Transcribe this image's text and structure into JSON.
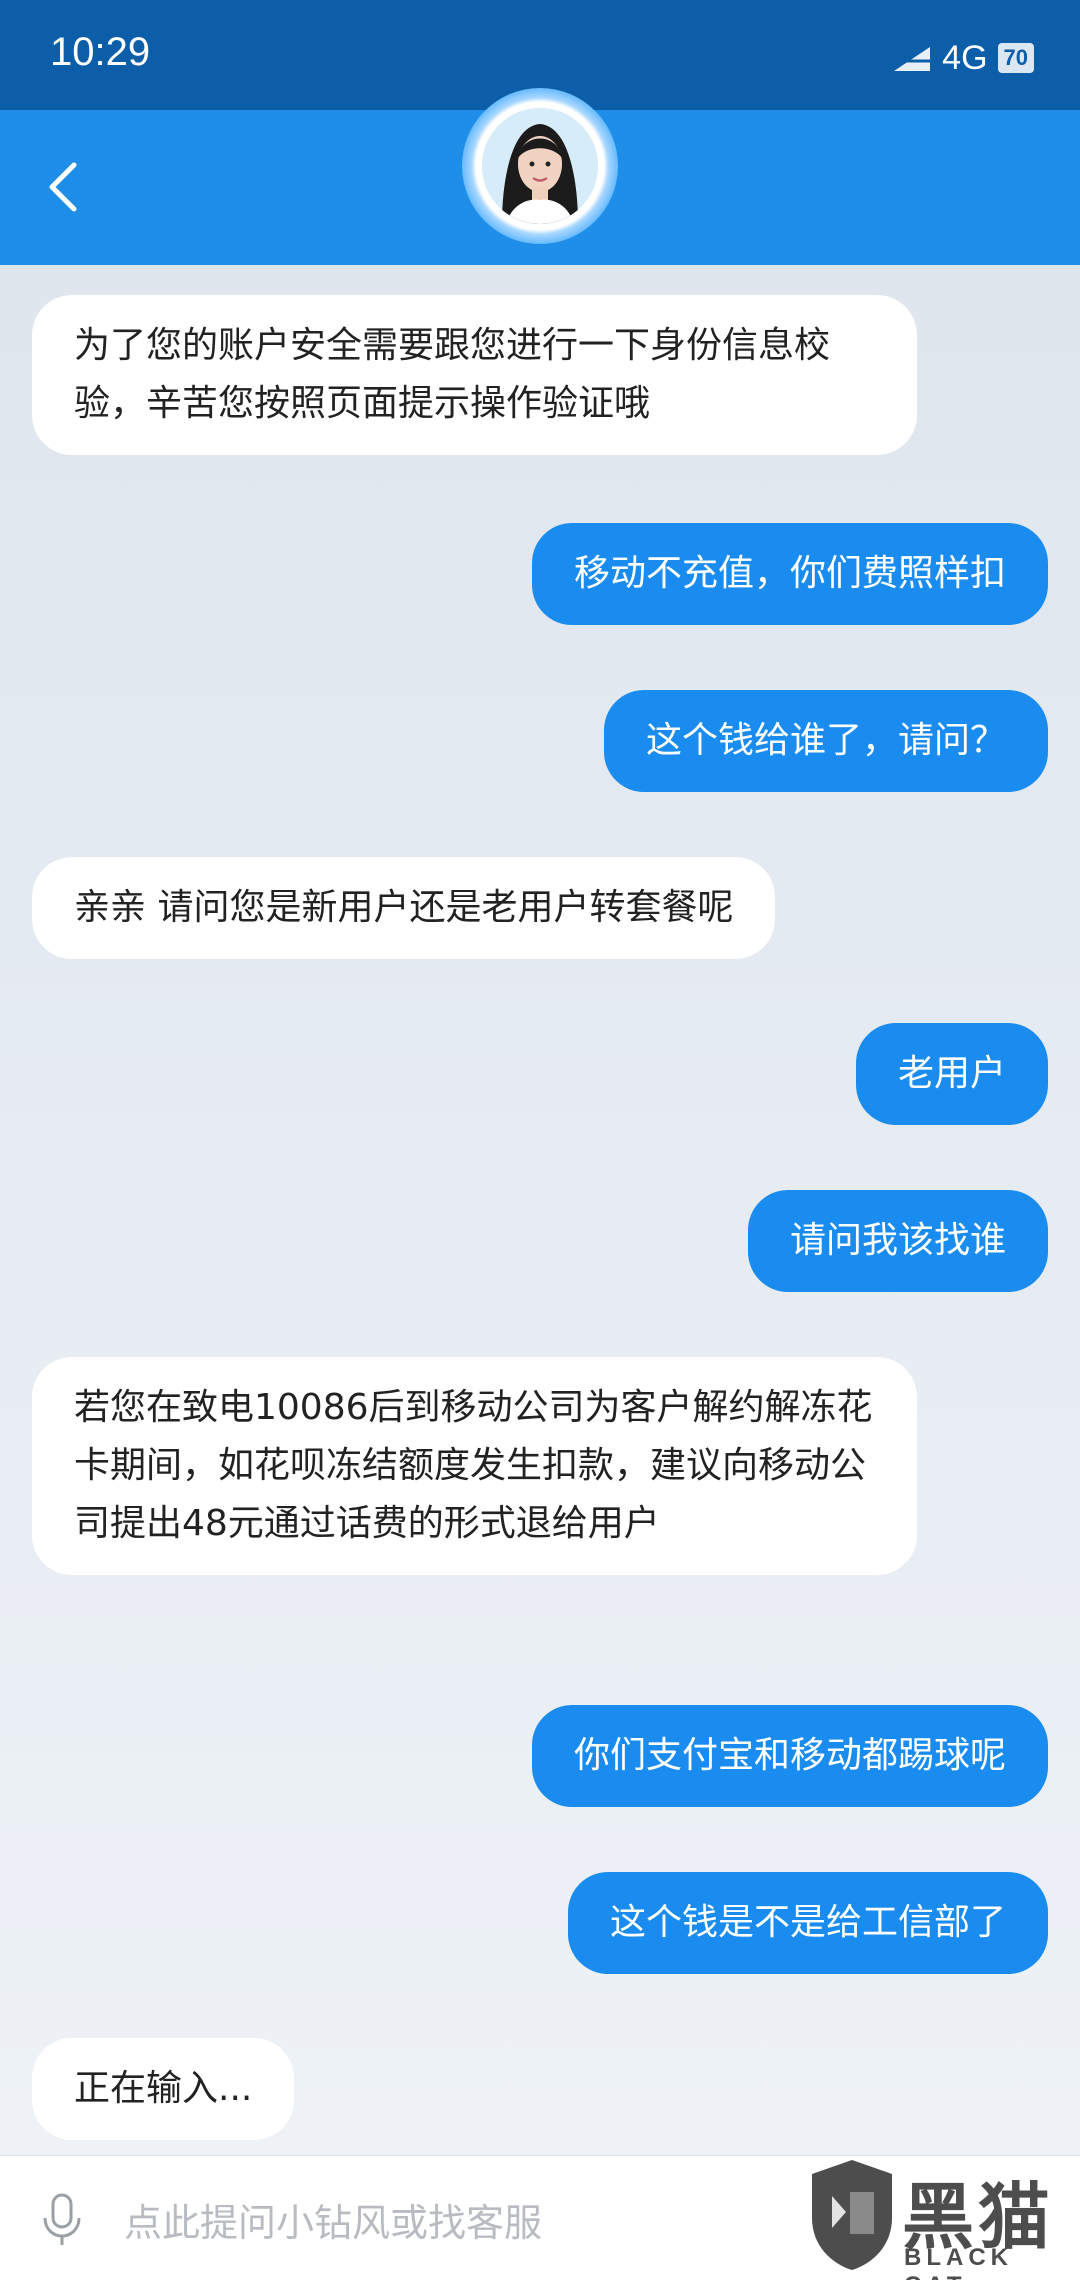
{
  "status_bar": {
    "time": "10:29",
    "network": "4G",
    "battery": "70"
  },
  "header": {
    "back_icon": "chevron-left-icon",
    "avatar_icon": "agent-avatar"
  },
  "messages": [
    {
      "side": "in",
      "text": "为了您的账户安全需要跟您进行一下身份信息校验，辛苦您按照页面提示操作验证哦"
    },
    {
      "side": "out",
      "text": "移动不充值，你们费照样扣"
    },
    {
      "side": "out",
      "text": "这个钱给谁了，请问？"
    },
    {
      "side": "in",
      "text": "亲亲 请问您是新用户还是老用户转套餐呢"
    },
    {
      "side": "out",
      "text": "老用户"
    },
    {
      "side": "out",
      "text": "请问我该找谁"
    },
    {
      "side": "in",
      "text": "若您在致电10086后到移动公司为客户解约解冻花卡期间，如花呗冻结额度发生扣款，建议向移动公司提出48元通过话费的形式退给用户"
    },
    {
      "side": "out",
      "text": "你们支付宝和移动都踢球呢"
    },
    {
      "side": "out",
      "text": "这个钱是不是给工信部了"
    },
    {
      "side": "in",
      "text": "正在输入..."
    }
  ],
  "input_bar": {
    "mic_icon": "microphone-icon",
    "placeholder": "点此提问小钻风或找客服"
  },
  "watermark": {
    "cn": "黑猫",
    "en": "BLACK CAT"
  },
  "colors": {
    "status_bar": "#0d5ea8",
    "header": "#1f8ee8",
    "outgoing_bubble": "#1a8cf0",
    "incoming_bubble": "#ffffff"
  }
}
